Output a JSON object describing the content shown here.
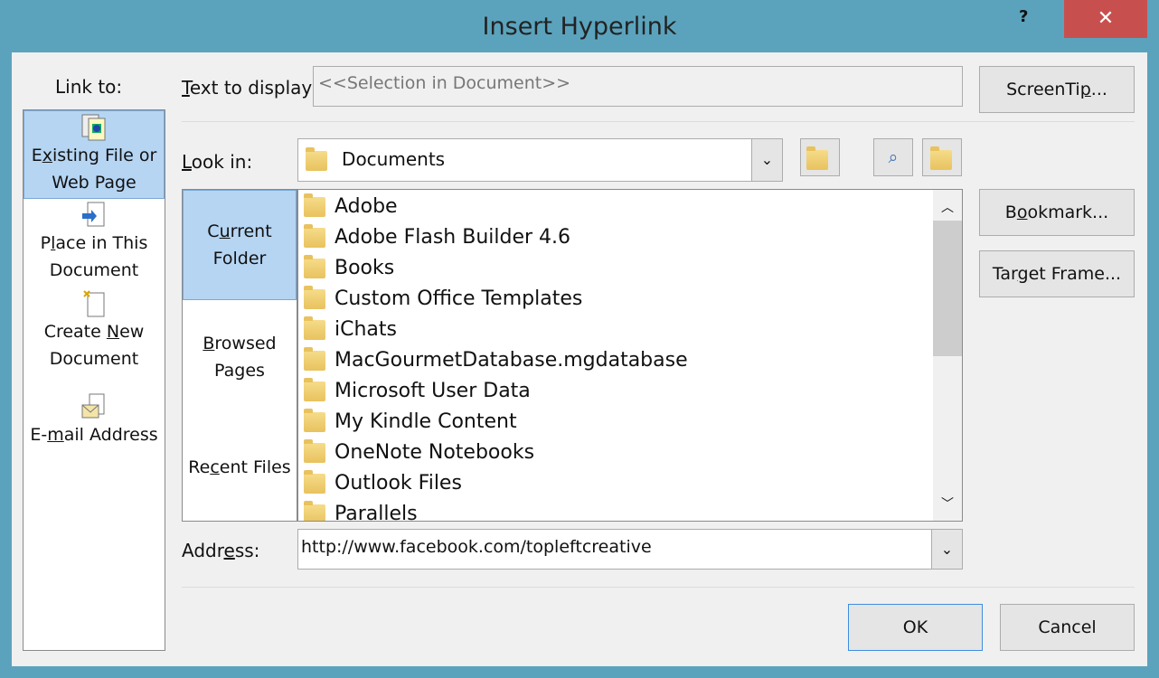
{
  "window": {
    "title": "Insert Hyperlink",
    "help": "?",
    "close": "✕"
  },
  "link_to": {
    "label": "Link to:",
    "items": [
      {
        "pre": "E",
        "key": "x",
        "post": "isting File or",
        "line2": "Web Page",
        "icon": "existing-file-icon",
        "selected": true
      },
      {
        "pre": "P",
        "key": "l",
        "post": "ace in This",
        "line2": "Document",
        "icon": "place-in-document-icon"
      },
      {
        "pre": "Create ",
        "key": "N",
        "post": "ew",
        "line2": "Document",
        "icon": "create-new-document-icon"
      },
      {
        "pre": "E-",
        "key": "m",
        "post": "ail Address",
        "line2": "",
        "icon": "email-address-icon"
      }
    ]
  },
  "text_to_display": {
    "pre": "",
    "key": "T",
    "post": "ext to display:",
    "value": "<<Selection in Document>>"
  },
  "look_in": {
    "pre": "",
    "key": "L",
    "post": "ook in:",
    "value": "Documents"
  },
  "toolbar": [
    "up-folder-icon",
    "browse-web-icon",
    "browse-file-icon"
  ],
  "places": [
    {
      "pre": "C",
      "key": "u",
      "post": "rrent",
      "line2": "Folder",
      "selected": true
    },
    {
      "pre": "",
      "key": "B",
      "post": "rowsed",
      "line2": "Pages"
    },
    {
      "pre": "Re",
      "key": "c",
      "post": "ent Files",
      "line2": ""
    }
  ],
  "files": [
    "Adobe",
    "Adobe Flash Builder 4.6",
    "Books",
    "Custom Office Templates",
    "iChats",
    "MacGourmetDatabase.mgdatabase",
    "Microsoft User Data",
    "My Kindle Content",
    "OneNote Notebooks",
    "Outlook Files",
    "Parallels"
  ],
  "address": {
    "pre": "Addr",
    "key": "e",
    "post": "ss:",
    "value": "http://www.facebook.com/topleftcreative"
  },
  "buttons": {
    "screentip": {
      "pre": "ScreenTi",
      "key": "p",
      "post": "..."
    },
    "bookmark": {
      "pre": "B",
      "key": "o",
      "post": "okmark..."
    },
    "target": {
      "pre": "Tar",
      "key": "g",
      "post": "et Frame..."
    },
    "ok": "OK",
    "cancel": "Cancel"
  }
}
